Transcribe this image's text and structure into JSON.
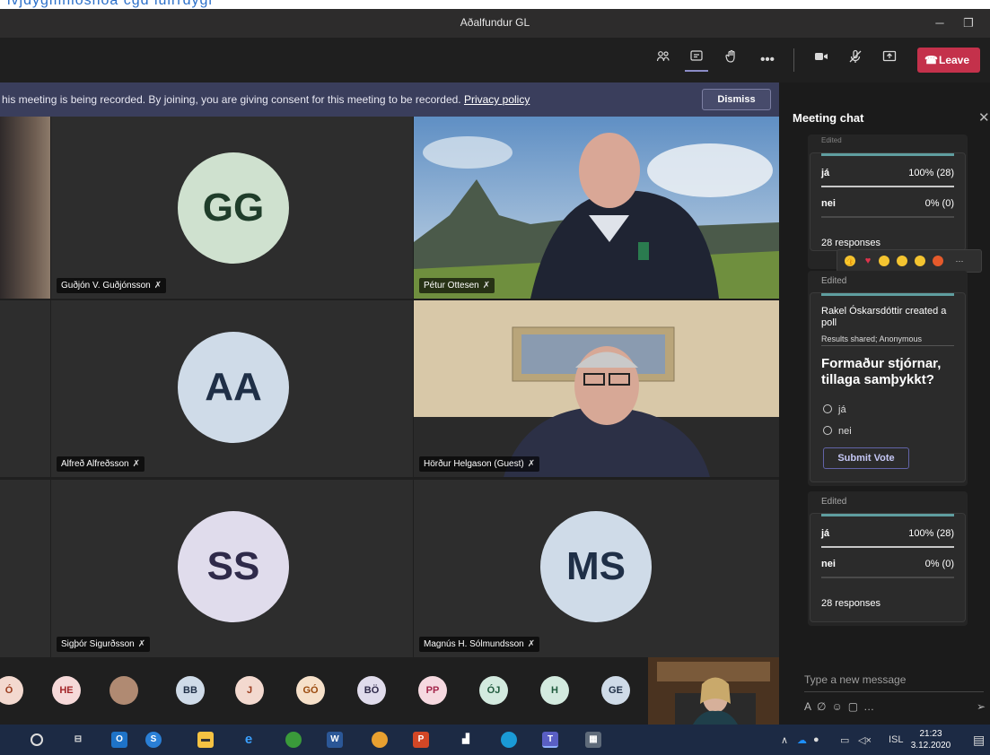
{
  "top_strip_text": "lvjdygmhloshoa cgd iulrrdygl",
  "window": {
    "title": "Aðalfundur GL",
    "minimize": "─",
    "restore": "❐"
  },
  "toolbar": {
    "participants_icon": "people-icon",
    "chat_icon": "chat-icon",
    "raise_hand_icon": "hand-icon",
    "more_icon": "more-icon",
    "camera_icon": "camera-icon",
    "mic_icon": "mic-off-icon",
    "share_icon": "share-icon",
    "leave_label": "Leave"
  },
  "banner": {
    "message": "his meeting is being recorded. By joining, you are giving consent for this meeting to be recorded.",
    "link": "Privacy policy",
    "dismiss": "Dismiss"
  },
  "tiles": [
    {
      "initials": "GG",
      "name": "Guðjón V. Guðjónsson",
      "bg": "#cfe1cf",
      "fg": "#1f3d2a"
    },
    {
      "name": "Pétur Ottesen"
    },
    {
      "initials": "AA",
      "name": "Alfreð Alfreðsson",
      "bg": "#cfdbe8",
      "fg": "#1f2f47"
    },
    {
      "name": "Hörður Helgason (Guest)"
    },
    {
      "initials": "SS",
      "name": "Sigþór Sigurðsson",
      "bg": "#e0dcec",
      "fg": "#2f2a4a"
    },
    {
      "initials": "MS",
      "name": "Magnús H. Sólmundsson",
      "bg": "#cfdbe8",
      "fg": "#1f2f47"
    }
  ],
  "chat": {
    "title": "Meeting chat",
    "close": "✕",
    "edited_label": "Edited",
    "edited_top_partial": "Edited",
    "results_1": {
      "rows": [
        {
          "option": "já",
          "value": "100% (28)",
          "fill": 1.0
        },
        {
          "option": "nei",
          "value": "0% (0)",
          "fill": 0.0
        }
      ],
      "responses": "28 responses"
    },
    "poll": {
      "creator": "Rakel Óskarsdóttir created a poll",
      "meta": "Results shared; Anonymous",
      "question": "Formaður stjórnar, tillaga samþykkt?",
      "options": [
        "já",
        "nei"
      ],
      "submit": "Submit Vote"
    },
    "results_2": {
      "rows": [
        {
          "option": "já",
          "value": "100% (28)",
          "fill": 1.0
        },
        {
          "option": "nei",
          "value": "0% (0)",
          "fill": 0.0
        }
      ],
      "responses": "28 responses"
    },
    "compose_placeholder": "Type a new message",
    "reaction_more": "···"
  },
  "participants": [
    {
      "initials": "Ó",
      "bg": "#f3d9cf",
      "fg": "#9a3b1d"
    },
    {
      "initials": "HE",
      "bg": "#f6d9d9",
      "fg": "#a3262a"
    },
    {
      "initials": "",
      "bg": "#b08a72",
      "fg": "#fff"
    },
    {
      "initials": "BB",
      "bg": "#cfdbe8",
      "fg": "#1f2f47"
    },
    {
      "initials": "J",
      "bg": "#f3d9cf",
      "fg": "#9a3b1d"
    },
    {
      "initials": "GÓ",
      "bg": "#f6e0c9",
      "fg": "#9a4a0d"
    },
    {
      "initials": "BÖ",
      "bg": "#e0dcec",
      "fg": "#2f2a4a"
    },
    {
      "initials": "PP",
      "bg": "#f6d9e0",
      "fg": "#a3264a"
    },
    {
      "initials": "ÓJ",
      "bg": "#d3eadf",
      "fg": "#1f5a3d"
    },
    {
      "initials": "H",
      "bg": "#d3eadf",
      "fg": "#1f5a3d"
    },
    {
      "initials": "GE",
      "bg": "#cfdbe8",
      "fg": "#1f2f47"
    }
  ],
  "taskbar": {
    "lang": "ISL",
    "time": "21:23",
    "date": "3.12.2020"
  }
}
